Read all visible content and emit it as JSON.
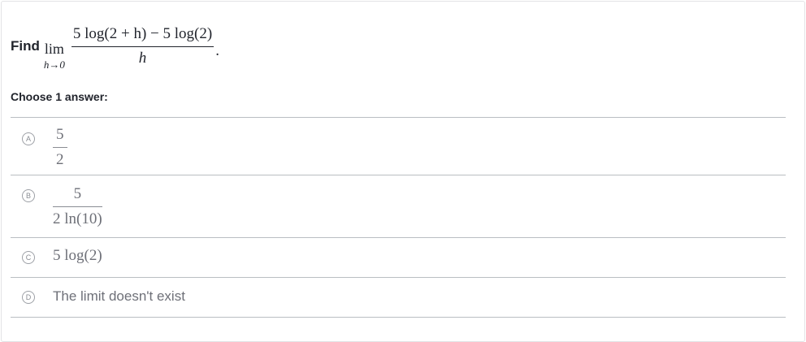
{
  "question": {
    "prompt": "Find",
    "lim_word": "lim",
    "lim_sub": "h→0",
    "numerator": "5 log(2 + h) − 5 log(2)",
    "denominator": "h",
    "period": "."
  },
  "choose_label": "Choose 1 answer:",
  "choices": [
    {
      "letter": "A",
      "numerator": "5",
      "denominator": "2"
    },
    {
      "letter": "B",
      "numerator": "5",
      "denominator": "2 ln(10)"
    },
    {
      "letter": "C",
      "text": "5 log(2)"
    },
    {
      "letter": "D",
      "text": "The limit doesn't exist"
    }
  ],
  "colors": {
    "text": "#21242c",
    "muted_text": "#6e7078",
    "divider": "#babec2",
    "card_border": "#e2e3e5"
  }
}
